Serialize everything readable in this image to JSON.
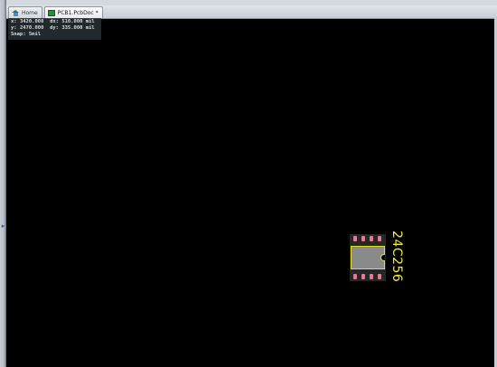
{
  "tabs": [
    {
      "label": "Home",
      "icon": "home-icon",
      "active": false
    },
    {
      "label": "PCB1.PcbDoc *",
      "icon": "pcb-document-icon",
      "active": true
    }
  ],
  "coords": {
    "x_label": "x:",
    "x_value": "3420.000",
    "dx_label": "dx:",
    "dx_value": "510.000 mil",
    "y_label": "y:",
    "y_value": "2470.000",
    "dy_label": "dy:",
    "dy_value": "335.000 mil",
    "snap": "Snap: 5mil"
  },
  "component": {
    "designator": "24C256",
    "pad_color": "#e8778f",
    "outline_color": "#e0e01a",
    "label_color": "#f3f01a"
  },
  "colors": {
    "canvas": "#000000",
    "chrome": "#c9cdd3"
  }
}
